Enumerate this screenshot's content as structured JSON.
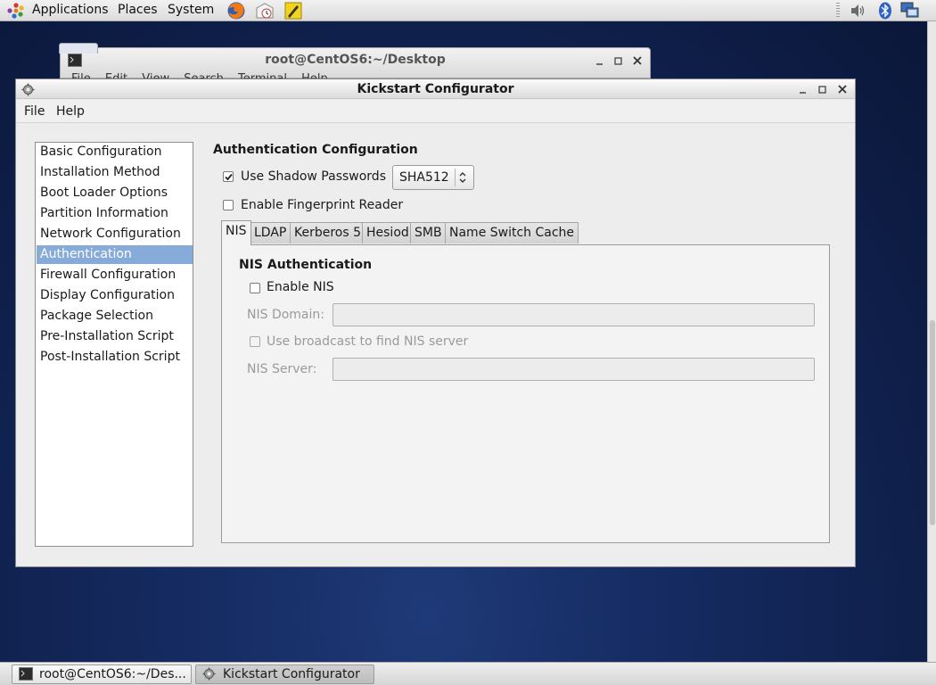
{
  "top_panel": {
    "menus": [
      "Applications",
      "Places",
      "System"
    ],
    "launchers": [
      "firefox-icon",
      "mail-clock-icon",
      "notes-icon"
    ],
    "tray": [
      "volume-icon",
      "bluetooth-icon",
      "network-icon"
    ]
  },
  "terminal_window": {
    "title": "root@CentOS6:~/Desktop",
    "menus": [
      "File",
      "Edit",
      "View",
      "Search",
      "Terminal",
      "Help"
    ]
  },
  "kickstart_window": {
    "title": "Kickstart Configurator",
    "menubar": [
      "File",
      "Help"
    ],
    "sidebar": {
      "items": [
        "Basic Configuration",
        "Installation Method",
        "Boot Loader Options",
        "Partition Information",
        "Network Configuration",
        "Authentication",
        "Firewall Configuration",
        "Display Configuration",
        "Package Selection",
        "Pre-Installation Script",
        "Post-Installation Script"
      ],
      "selected": "Authentication"
    },
    "auth": {
      "heading": "Authentication Configuration",
      "shadow_label": "Use Shadow Passwords",
      "shadow_checked": true,
      "hash_value": "SHA512",
      "fingerprint_label": "Enable Fingerprint Reader",
      "fingerprint_checked": false,
      "tabs": [
        "NIS",
        "LDAP",
        "Kerberos 5",
        "Hesiod",
        "SMB",
        "Name Switch Cache"
      ],
      "active_tab": "NIS",
      "nis": {
        "heading": "NIS Authentication",
        "enable_label": "Enable NIS",
        "enable_checked": false,
        "domain_label": "NIS Domain:",
        "domain_value": "",
        "broadcast_label": "Use broadcast to find NIS server",
        "broadcast_checked": false,
        "server_label": "NIS Server:",
        "server_value": ""
      }
    }
  },
  "taskbar": {
    "tasks": [
      "root@CentOS6:~/Des...",
      "Kickstart Configurator"
    ]
  },
  "colors": {
    "selection": "#86abd9",
    "desktop": "#162c63"
  }
}
